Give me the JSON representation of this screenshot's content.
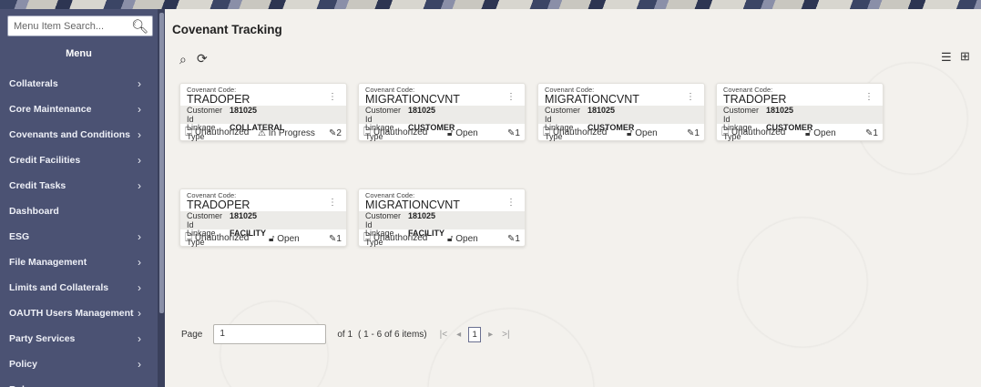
{
  "sidebar": {
    "search_placeholder": "Menu Item Search...",
    "menu_title": "Menu",
    "items": [
      {
        "label": "Collaterals",
        "has_children": true
      },
      {
        "label": "Core Maintenance",
        "has_children": true
      },
      {
        "label": "Covenants and Conditions",
        "has_children": true
      },
      {
        "label": "Credit Facilities",
        "has_children": true
      },
      {
        "label": "Credit Tasks",
        "has_children": true
      },
      {
        "label": "Dashboard",
        "has_children": false
      },
      {
        "label": "ESG",
        "has_children": true
      },
      {
        "label": "File Management",
        "has_children": true
      },
      {
        "label": "Limits and Collaterals",
        "has_children": true
      },
      {
        "label": "OAUTH Users Management",
        "has_children": true
      },
      {
        "label": "Party Services",
        "has_children": true
      },
      {
        "label": "Policy",
        "has_children": true
      },
      {
        "label": "Rule",
        "has_children": true
      }
    ]
  },
  "main": {
    "title": "Covenant Tracking",
    "card_labels": {
      "covenant_code": "Covenant Code:",
      "customer_id": "Customer Id",
      "linkage_type": "Linkage Type"
    },
    "cards": [
      {
        "code": "TRADOPER",
        "customer_id": "181025",
        "linkage_type": "COLLATERAL",
        "auth": "Unauthorized",
        "status": "In Progress",
        "status_icon": "warning-icon",
        "count": "2"
      },
      {
        "code": "MIGRATIONCVNT",
        "customer_id": "181025",
        "linkage_type": "CUSTOMER",
        "auth": "Unauthorized",
        "status": "Open",
        "status_icon": "unlock-icon",
        "count": "1"
      },
      {
        "code": "MIGRATIONCVNT",
        "customer_id": "181025",
        "linkage_type": "CUSTOMER",
        "auth": "Unauthorized",
        "status": "Open",
        "status_icon": "unlock-icon",
        "count": "1"
      },
      {
        "code": "TRADOPER",
        "customer_id": "181025",
        "linkage_type": "CUSTOMER",
        "auth": "Unauthorized",
        "status": "Open",
        "status_icon": "unlock-icon",
        "count": "1"
      },
      {
        "code": "TRADOPER",
        "customer_id": "181025",
        "linkage_type": "FACILITY",
        "auth": "Unauthorized",
        "status": "Open",
        "status_icon": "unlock-icon",
        "count": "1"
      },
      {
        "code": "MIGRATIONCVNT",
        "customer_id": "181025",
        "linkage_type": "FACILITY",
        "auth": "Unauthorized",
        "status": "Open",
        "status_icon": "unlock-icon",
        "count": "1"
      }
    ],
    "pagination": {
      "page_label": "Page",
      "page_value": "1",
      "of_text": "of 1",
      "items_text": "( 1 - 6 of 6 items)",
      "current_page": "1"
    }
  }
}
